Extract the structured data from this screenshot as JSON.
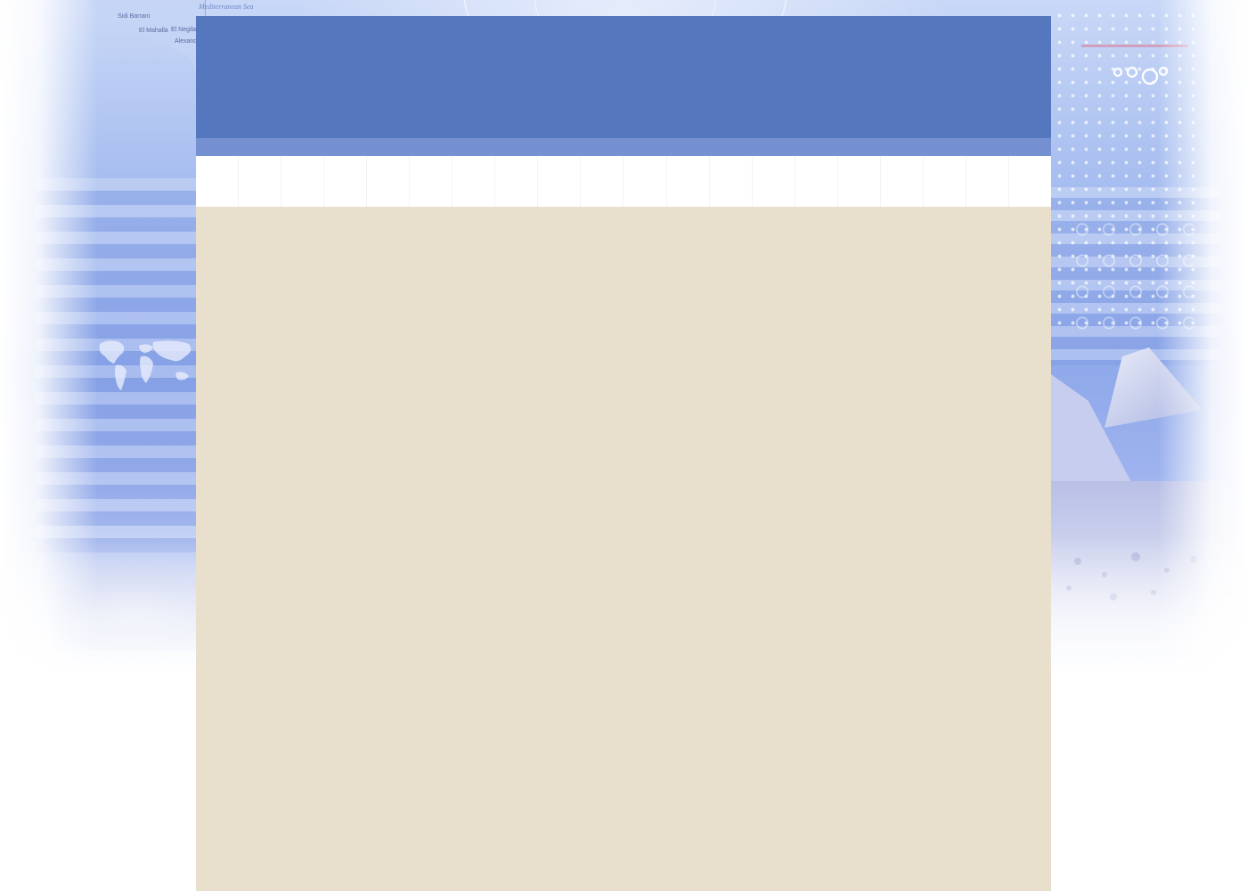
{
  "background": {
    "sea_label": "Mediterranean Sea",
    "map_labels": [
      "Sidi Barrani",
      "El Mahalla",
      "El Negila",
      "Alexandria"
    ]
  },
  "colors": {
    "header": "#5577bd",
    "sub_header": "#7590d0",
    "nav_strip": "#ffffff",
    "content": "#e8e0cc",
    "page_background": "#ffffff"
  },
  "navigation": {
    "item_count_visible": 20
  }
}
